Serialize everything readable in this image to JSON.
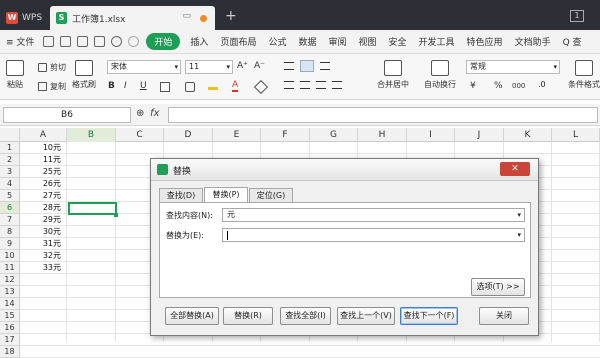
{
  "titlebar": {
    "app_tab": "WPS",
    "doc_tab": "工作簿1.xlsx",
    "new_tab": "+",
    "window_count": "1"
  },
  "menubar": {
    "file": "≡ 文件",
    "start": "开始",
    "items": [
      "插入",
      "页面布局",
      "公式",
      "数据",
      "审阅",
      "视图",
      "安全",
      "开发工具",
      "特色应用",
      "文档助手"
    ],
    "search": "Q 查"
  },
  "toolbar": {
    "paste": "粘贴",
    "cut": "剪切",
    "copy": "复制",
    "format_painter": "格式刷",
    "font_name": "宋体",
    "font_size": "11",
    "grow_font": "A⁺",
    "shrink_font": "A⁻",
    "bold": "B",
    "italic": "I",
    "underline": "U",
    "merge_center": "合并居中",
    "wrap_text": "自动换行",
    "number_format": "常规",
    "currency": "¥",
    "percent": "%",
    "thousands": "000",
    "cond_format": "条件格式"
  },
  "formula_bar": {
    "name_box": "B6",
    "fx": "fx",
    "zoom": "⊕"
  },
  "grid": {
    "columns": [
      "A",
      "B",
      "C",
      "D",
      "E",
      "F",
      "G",
      "H",
      "I",
      "J",
      "K",
      "L"
    ],
    "selected_column": "B",
    "rows": [
      "1",
      "2",
      "3",
      "4",
      "5",
      "6",
      "7",
      "8",
      "9",
      "10",
      "11",
      "12",
      "13",
      "14",
      "15",
      "16",
      "17",
      "18"
    ],
    "selected_row": "6",
    "column_a_values": [
      "10元",
      "11元",
      "25元",
      "26元",
      "27元",
      "28元",
      "29元",
      "30元",
      "31元",
      "32元",
      "33元"
    ]
  },
  "dialog": {
    "title": "替换",
    "close": "✕",
    "tabs": [
      "查找(D)",
      "替换(P)",
      "定位(G)"
    ],
    "active_tab": "替换(P)",
    "find_label": "查找内容(N):",
    "find_value": "元",
    "replace_label": "替换为(E):",
    "replace_value": "",
    "options_button": "选项(T) >>",
    "buttons": {
      "replace_all": "全部替换(A)",
      "replace": "替换(R)",
      "find_all": "查找全部(I)",
      "find_prev": "查找上一个(V)",
      "find_next": "查找下一个(F)",
      "close": "关闭"
    }
  },
  "colors": {
    "accent": "#1e9e56",
    "titlebar": "#2c2f36",
    "close_red": "#c9453a"
  }
}
